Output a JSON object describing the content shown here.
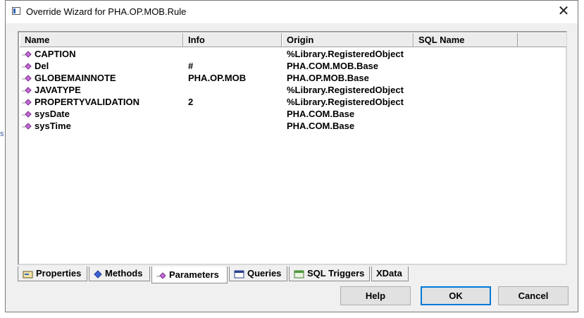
{
  "window": {
    "title": "Override Wizard for PHA.OP.MOB.Rule"
  },
  "background": {
    "fragment": "s"
  },
  "list": {
    "columns": [
      "Name",
      "Info",
      "Origin",
      "SQL Name"
    ],
    "rows": [
      {
        "name": "CAPTION",
        "info": "",
        "origin": "%Library.RegisteredObject",
        "sql": ""
      },
      {
        "name": "Del",
        "info": "#",
        "origin": "PHA.COM.MOB.Base",
        "sql": ""
      },
      {
        "name": "GLOBEMAINNOTE",
        "info": "PHA.OP.MOB",
        "origin": "PHA.OP.MOB.Base",
        "sql": ""
      },
      {
        "name": "JAVATYPE",
        "info": "",
        "origin": "%Library.RegisteredObject",
        "sql": ""
      },
      {
        "name": "PROPERTYVALIDATION",
        "info": "2",
        "origin": "%Library.RegisteredObject",
        "sql": ""
      },
      {
        "name": "sysDate",
        "info": "",
        "origin": "PHA.COM.Base",
        "sql": ""
      },
      {
        "name": "sysTime",
        "info": "",
        "origin": "PHA.COM.Base",
        "sql": ""
      }
    ]
  },
  "tabs": [
    {
      "label": "Properties",
      "icon": "properties-icon"
    },
    {
      "label": "Methods",
      "icon": "methods-icon"
    },
    {
      "label": "Parameters",
      "icon": "parameters-icon",
      "active": true
    },
    {
      "label": "Queries",
      "icon": "queries-icon"
    },
    {
      "label": "SQL Triggers",
      "icon": "sql-triggers-icon"
    },
    {
      "label": "XData",
      "icon": ""
    }
  ],
  "buttons": {
    "help": "Help",
    "ok": "OK",
    "cancel": "Cancel"
  }
}
